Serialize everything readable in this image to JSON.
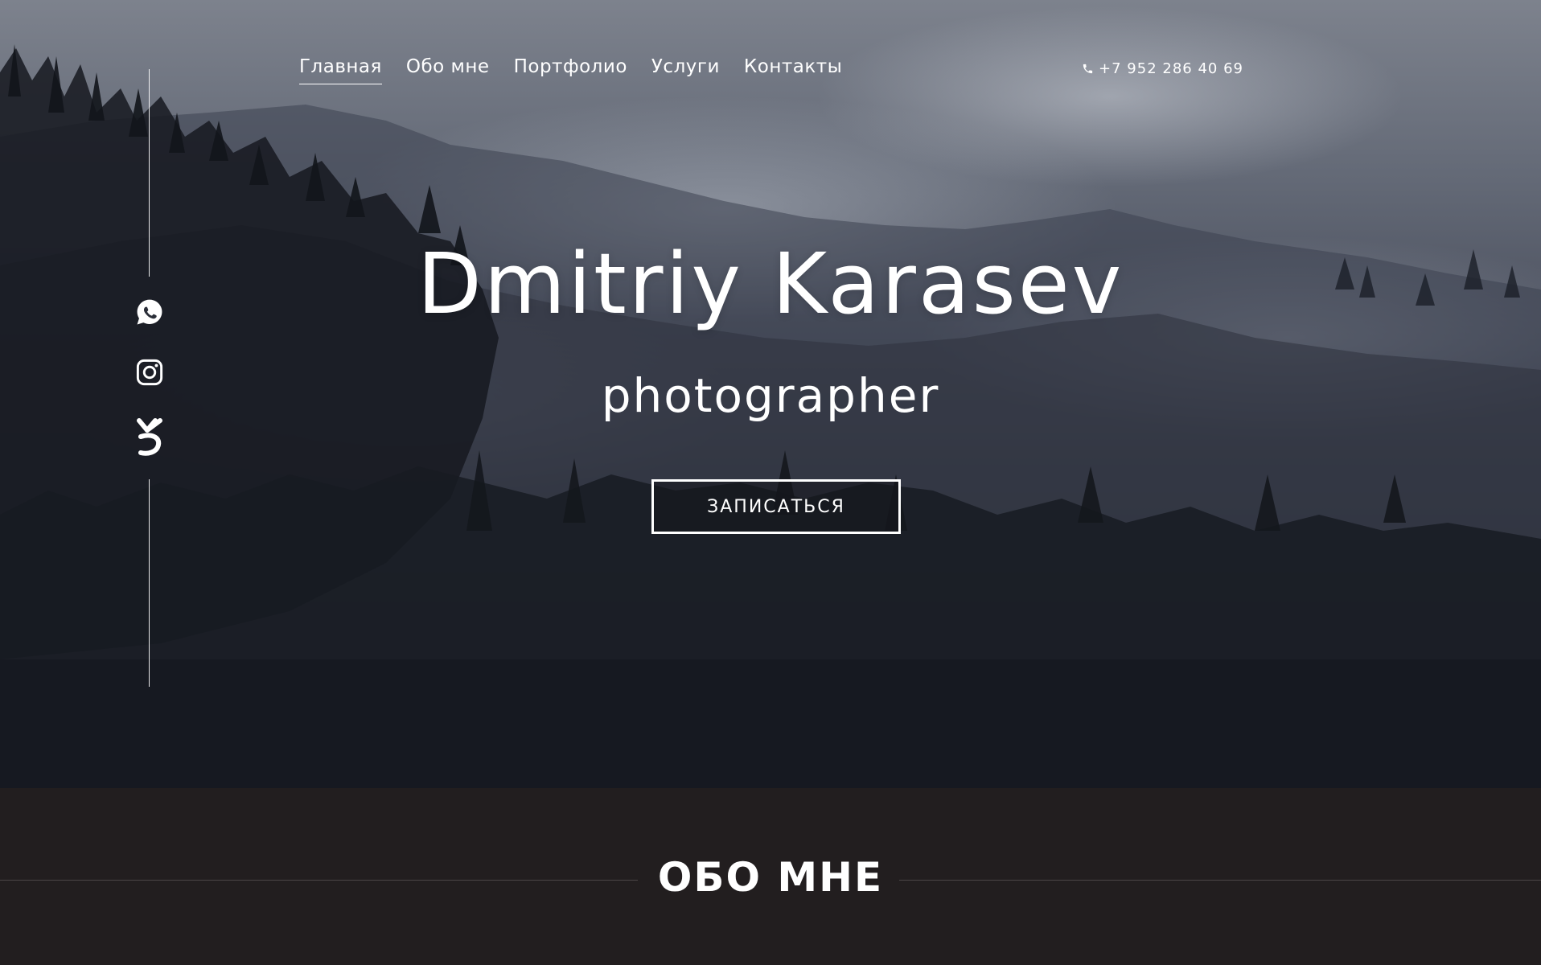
{
  "nav": {
    "items": [
      {
        "label": "Главная",
        "active": true
      },
      {
        "label": "Обо мне",
        "active": false
      },
      {
        "label": "Портфолио",
        "active": false
      },
      {
        "label": "Услуги",
        "active": false
      },
      {
        "label": "Контакты",
        "active": false
      }
    ]
  },
  "contact": {
    "phone": "+7 952 286 40 69",
    "phone_icon": "phone-icon"
  },
  "social": [
    {
      "name": "whatsapp-icon"
    },
    {
      "name": "instagram-icon"
    },
    {
      "name": "vk-icon"
    }
  ],
  "hero": {
    "title": "Dmitriy Karasev",
    "subtitle": "photographer",
    "cta_label": "ЗАПИСАТЬСЯ"
  },
  "about": {
    "title": "ОБО МНЕ"
  },
  "colors": {
    "section_background": "#221e1f",
    "text": "#ffffff"
  }
}
